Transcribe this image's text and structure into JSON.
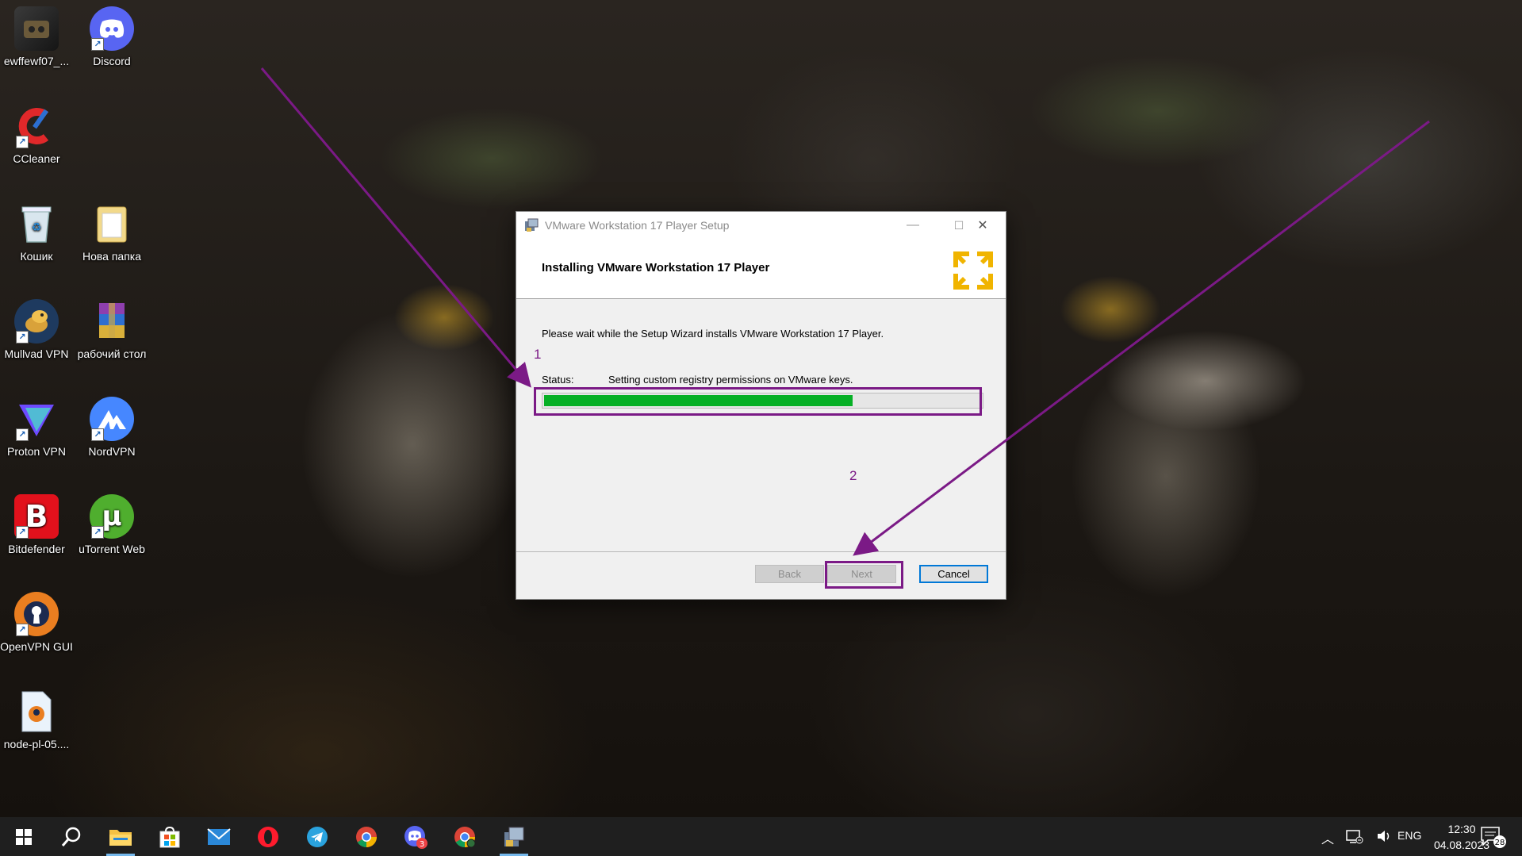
{
  "desktop": {
    "icons": [
      {
        "label": "ewffewf07_...",
        "icon": "game-icon"
      },
      {
        "label": "Discord",
        "icon": "discord-icon"
      },
      {
        "label": "CCleaner",
        "icon": "ccleaner-icon"
      },
      {
        "label": "Кошик",
        "icon": "recycle-bin-icon"
      },
      {
        "label": "Нова папка",
        "icon": "folder-icon"
      },
      {
        "label": "Mullvad VPN",
        "icon": "mullvad-icon"
      },
      {
        "label": "рабочий стол",
        "icon": "winrar-archive-icon"
      },
      {
        "label": "Proton VPN",
        "icon": "proton-vpn-icon"
      },
      {
        "label": "NordVPN",
        "icon": "nordvpn-icon"
      },
      {
        "label": "Bitdefender",
        "icon": "bitdefender-icon"
      },
      {
        "label": "uTorrent Web",
        "icon": "utorrent-icon"
      },
      {
        "label": "OpenVPN GUI",
        "icon": "openvpn-icon"
      },
      {
        "label": "node-pl-05....",
        "icon": "openvpn-config-file-icon"
      }
    ]
  },
  "dialog": {
    "title": "VMware Workstation 17 Player Setup",
    "heading": "Installing VMware Workstation 17 Player",
    "body": "Please wait while the Setup Wizard installs VMware Workstation 17 Player.",
    "status_label": "Status:",
    "status_text": "Setting custom registry permissions on VMware keys.",
    "progress": 0.7,
    "buttons": {
      "back": "Back",
      "next": "Next",
      "cancel": "Cancel"
    },
    "window_controls": {
      "minimize": "—",
      "maximize": "☐",
      "close": "✕"
    }
  },
  "annotations": {
    "label1": "1",
    "label2": "2",
    "color": "#7b1a86"
  },
  "taskbar": {
    "items": [
      "windows-start-icon",
      "search-icon",
      "file-explorer-icon",
      "microsoft-store-icon",
      "mail-icon",
      "opera-icon",
      "telegram-icon",
      "chrome-icon",
      "discord-taskbar-icon",
      "chrome-profile-icon",
      "vmware-setup-icon"
    ],
    "discord_badge": "3",
    "language": "ENG",
    "time": "12:30",
    "date": "04.08.2023",
    "notifications": "28"
  }
}
